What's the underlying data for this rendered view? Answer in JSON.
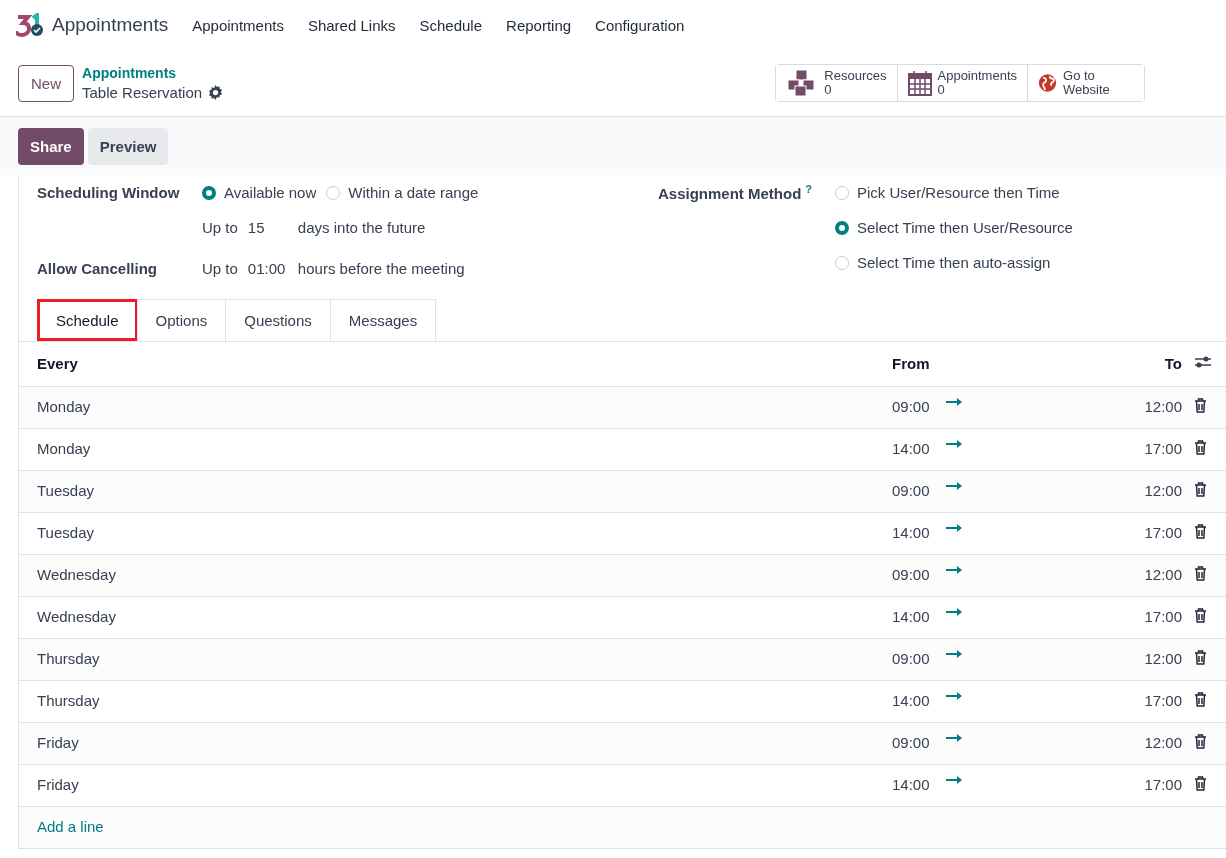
{
  "navbar": {
    "app_name": "Appointments",
    "menu": [
      "Appointments",
      "Shared Links",
      "Schedule",
      "Reporting",
      "Configuration"
    ]
  },
  "control_panel": {
    "new_button": "New",
    "breadcrumb": "Appointments",
    "record_title": "Table Reservation",
    "smart_buttons": [
      {
        "kind": "resources",
        "label": "Resources",
        "value": "0"
      },
      {
        "kind": "calendar",
        "label": "Appointments",
        "value": "0"
      },
      {
        "kind": "globe",
        "label": "Go to Website"
      }
    ]
  },
  "actions": [
    {
      "label": "Share",
      "primary": true
    },
    {
      "label": "Preview",
      "primary": false
    }
  ],
  "form": {
    "scheduling_window": {
      "label": "Scheduling Window",
      "options": [
        {
          "label": "Available now",
          "selected": true
        },
        {
          "label": "Within a date range",
          "selected": false
        }
      ],
      "prefix": "Up to",
      "value": "15",
      "suffix": "days into the future"
    },
    "allow_cancelling": {
      "label": "Allow Cancelling",
      "prefix": "Up to",
      "value": "01:00",
      "suffix": "hours before the meeting"
    },
    "assignment_method": {
      "label": "Assignment Method",
      "help": "?",
      "options": [
        {
          "label": "Pick User/Resource then Time",
          "selected": false
        },
        {
          "label": "Select Time then User/Resource",
          "selected": true
        },
        {
          "label": "Select Time then auto-assign",
          "selected": false
        }
      ]
    }
  },
  "tabs": [
    {
      "label": "Schedule",
      "selected": true,
      "highlighted": true
    },
    {
      "label": "Options",
      "selected": false,
      "highlighted": false
    },
    {
      "label": "Questions",
      "selected": false,
      "highlighted": false
    },
    {
      "label": "Messages",
      "selected": false,
      "highlighted": false
    }
  ],
  "table": {
    "columns": [
      "Every",
      "From",
      "To"
    ],
    "rows": [
      {
        "every": "Monday",
        "from": "09:00",
        "to": "12:00"
      },
      {
        "every": "Monday",
        "from": "14:00",
        "to": "17:00"
      },
      {
        "every": "Tuesday",
        "from": "09:00",
        "to": "12:00"
      },
      {
        "every": "Tuesday",
        "from": "14:00",
        "to": "17:00"
      },
      {
        "every": "Wednesday",
        "from": "09:00",
        "to": "12:00"
      },
      {
        "every": "Wednesday",
        "from": "14:00",
        "to": "17:00"
      },
      {
        "every": "Thursday",
        "from": "09:00",
        "to": "12:00"
      },
      {
        "every": "Thursday",
        "from": "14:00",
        "to": "17:00"
      },
      {
        "every": "Friday",
        "from": "09:00",
        "to": "12:00"
      },
      {
        "every": "Friday",
        "from": "14:00",
        "to": "17:00"
      }
    ],
    "add_line": "Add a line"
  }
}
